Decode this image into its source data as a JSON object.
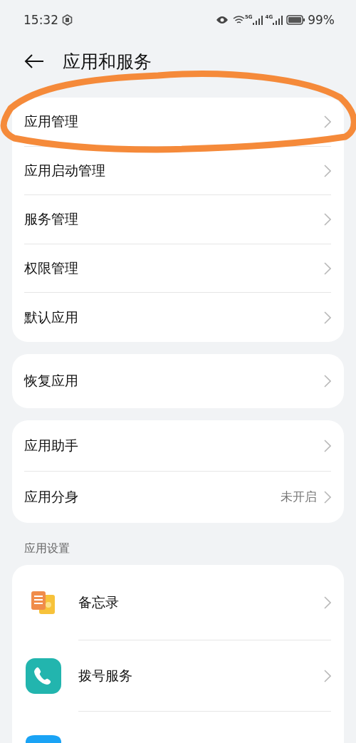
{
  "status_bar": {
    "time": "15:32",
    "battery": "99%",
    "network_1": "5G",
    "network_2": "4G"
  },
  "header": {
    "title": "应用和服务"
  },
  "groups": [
    {
      "items": [
        {
          "label": "应用管理"
        },
        {
          "label": "应用启动管理"
        },
        {
          "label": "服务管理"
        },
        {
          "label": "权限管理"
        },
        {
          "label": "默认应用"
        }
      ]
    },
    {
      "items": [
        {
          "label": "恢复应用"
        }
      ]
    },
    {
      "items": [
        {
          "label": "应用助手"
        },
        {
          "label": "应用分身",
          "value": "未开启"
        }
      ]
    }
  ],
  "section": {
    "title": "应用设置",
    "apps": [
      {
        "kind": "memo",
        "label": "备忘录"
      },
      {
        "kind": "phone",
        "label": "拨号服务"
      },
      {
        "kind": "blue"
      }
    ]
  },
  "annotation": {
    "kind": "circle"
  }
}
